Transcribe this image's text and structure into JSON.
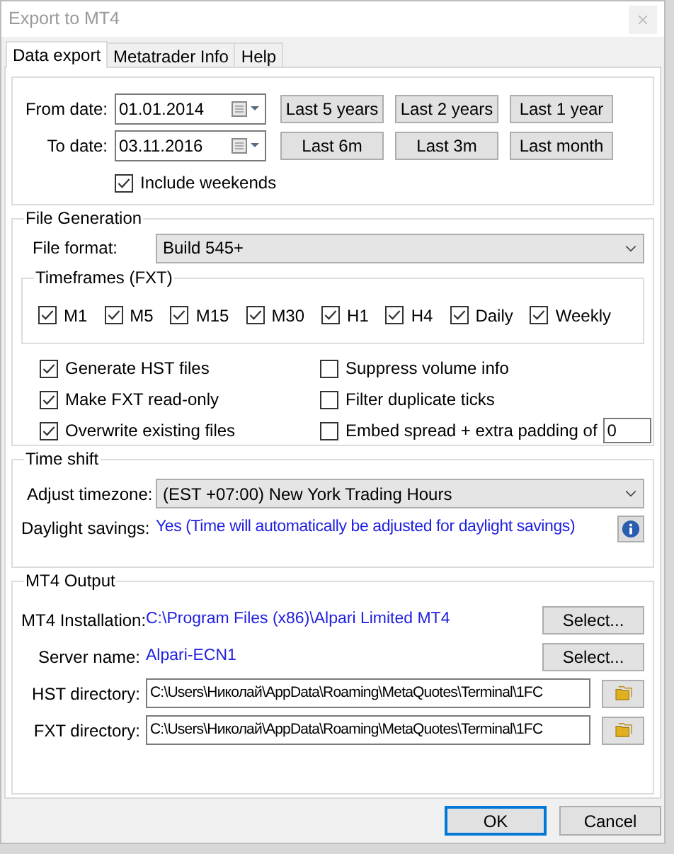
{
  "window": {
    "title": "Export to MT4"
  },
  "tabs": [
    {
      "label": "Data export",
      "selected": true
    },
    {
      "label": "Metatrader Info",
      "selected": false
    },
    {
      "label": "Help",
      "selected": false
    }
  ],
  "date_range": {
    "from": {
      "label": "From date:",
      "value": "01.01.2014"
    },
    "to": {
      "label": "To date:",
      "value": "03.11.2016"
    },
    "presets": [
      "Last 5 years",
      "Last 2 years",
      "Last 1 year",
      "Last 6m",
      "Last 3m",
      "Last month"
    ],
    "include_weekends": {
      "label": "Include weekends",
      "checked": true
    }
  },
  "file_generation": {
    "title": "File Generation",
    "file_format": {
      "label": "File format:",
      "value": "Build 545+"
    },
    "timeframes": {
      "title": "Timeframes (FXT)",
      "items": [
        {
          "label": "M1",
          "checked": true
        },
        {
          "label": "M5",
          "checked": true
        },
        {
          "label": "M15",
          "checked": true
        },
        {
          "label": "M30",
          "checked": true
        },
        {
          "label": "H1",
          "checked": true
        },
        {
          "label": "H4",
          "checked": true
        },
        {
          "label": "Daily",
          "checked": true
        },
        {
          "label": "Weekly",
          "checked": true
        }
      ]
    },
    "options": [
      {
        "kind": "checkbox",
        "label": "Generate HST files",
        "checked": true
      },
      {
        "kind": "checkbox",
        "label": "Suppress volume info",
        "checked": false
      },
      {
        "kind": "checkbox",
        "label": "Make FXT read-only",
        "checked": true
      },
      {
        "kind": "checkbox",
        "label": "Filter duplicate ticks",
        "checked": false
      },
      {
        "kind": "checkbox",
        "label": "Overwrite existing files",
        "checked": true
      },
      {
        "kind": "checkbox_input",
        "label": "Embed spread + extra padding of",
        "checked": false,
        "value": "0"
      }
    ]
  },
  "time_shift": {
    "title": "Time shift",
    "timezone": {
      "label": "Adjust timezone:",
      "value": "(EST +07:00) New York Trading Hours"
    },
    "daylight_savings": {
      "label": "Daylight savings:",
      "value": "Yes (Time will automatically be adjusted for daylight savings)"
    }
  },
  "mt4_output": {
    "title": "MT4 Output",
    "rows": [
      {
        "kind": "link",
        "label": "MT4 Installation:",
        "value": "C:\\Program Files (x86)\\Alpari Limited MT4",
        "button": "Select..."
      },
      {
        "kind": "link",
        "label": "Server name:",
        "value": "Alpari-ECN1",
        "button": "Select..."
      },
      {
        "kind": "path",
        "label": "HST directory:",
        "value": "C:\\Users\\Николай\\AppData\\Roaming\\MetaQuotes\\Terminal\\1FC"
      },
      {
        "kind": "path",
        "label": "FXT directory:",
        "value": "C:\\Users\\Николай\\AppData\\Roaming\\MetaQuotes\\Terminal\\1FC"
      }
    ]
  },
  "buttons": [
    {
      "label": "OK",
      "selected": true
    },
    {
      "label": "Cancel",
      "selected": false
    }
  ]
}
